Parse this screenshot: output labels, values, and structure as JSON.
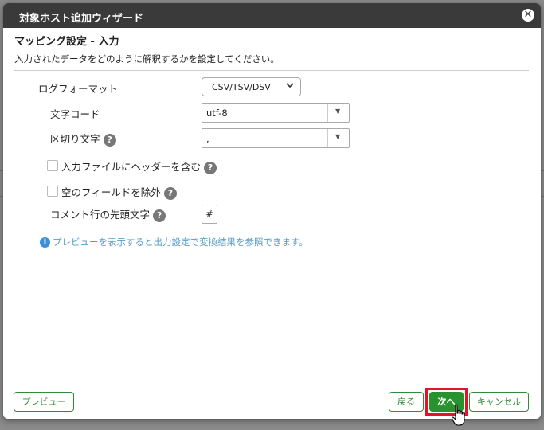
{
  "dialog": {
    "title": "対象ホスト追加ウィザード",
    "close_glyph": "✕"
  },
  "section": {
    "title": "マッピング設定 - 入力",
    "description": "入力されたデータをどのように解釈するかを設定してください。"
  },
  "form": {
    "log_format": {
      "label": "ログフォーマット",
      "value": "CSV/TSV/DSV"
    },
    "charset": {
      "label": "文字コード",
      "value": "utf-8"
    },
    "delimiter": {
      "label": "区切り文字",
      "value": ","
    },
    "header_row": {
      "label": "入力ファイルにヘッダーを含む",
      "checked": false
    },
    "exclude_empty": {
      "label": "空のフィールドを除外",
      "checked": false
    },
    "comment_char": {
      "label": "コメント行の先頭文字",
      "value": "#"
    },
    "help_glyph": "?"
  },
  "info": {
    "icon_glyph": "i",
    "text": "プレビューを表示すると出力設定で変換結果を参照できます。"
  },
  "footer": {
    "preview_label": "プレビュー",
    "back_label": "戻る",
    "next_label": "次へ",
    "cancel_label": "キャンセル"
  },
  "colors": {
    "titlebar": "#3a3a3a",
    "accent_green": "#28922e",
    "highlight_red": "#e0142b",
    "info_blue": "#3c91d6"
  }
}
